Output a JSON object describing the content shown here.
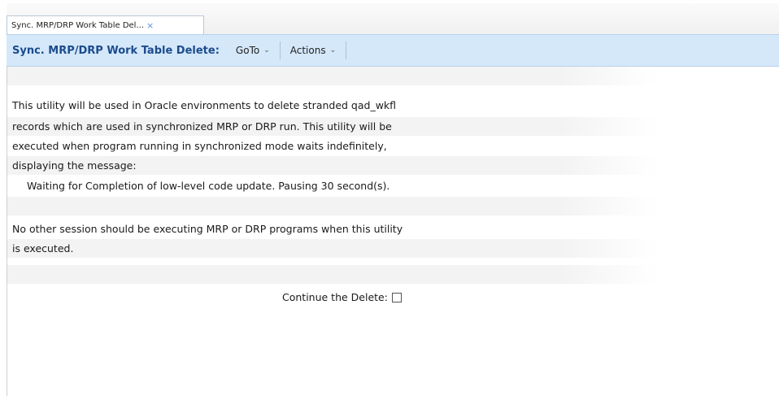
{
  "tab": {
    "title": "Sync. MRP/DRP Work Table Del...",
    "close_glyph": "×"
  },
  "toolbar": {
    "title": "Sync. MRP/DRP Work Table Delete:",
    "goto_label": "GoTo",
    "actions_label": "Actions",
    "caret": "⌄"
  },
  "content": {
    "lines": [
      "This utility will be used in Oracle environments to delete stranded qad_wkfl",
      "records which are used in synchronized MRP or DRP run.  This utility will be",
      "executed when program running in synchronized mode waits indefinitely,",
      "displaying the message:",
      "Waiting for Completion of low-level code update. Pausing 30 second(s).",
      "No other session should be executing MRP or DRP programs when this utility",
      "is executed."
    ],
    "continue_label": "Continue the Delete:",
    "continue_checked": false
  }
}
